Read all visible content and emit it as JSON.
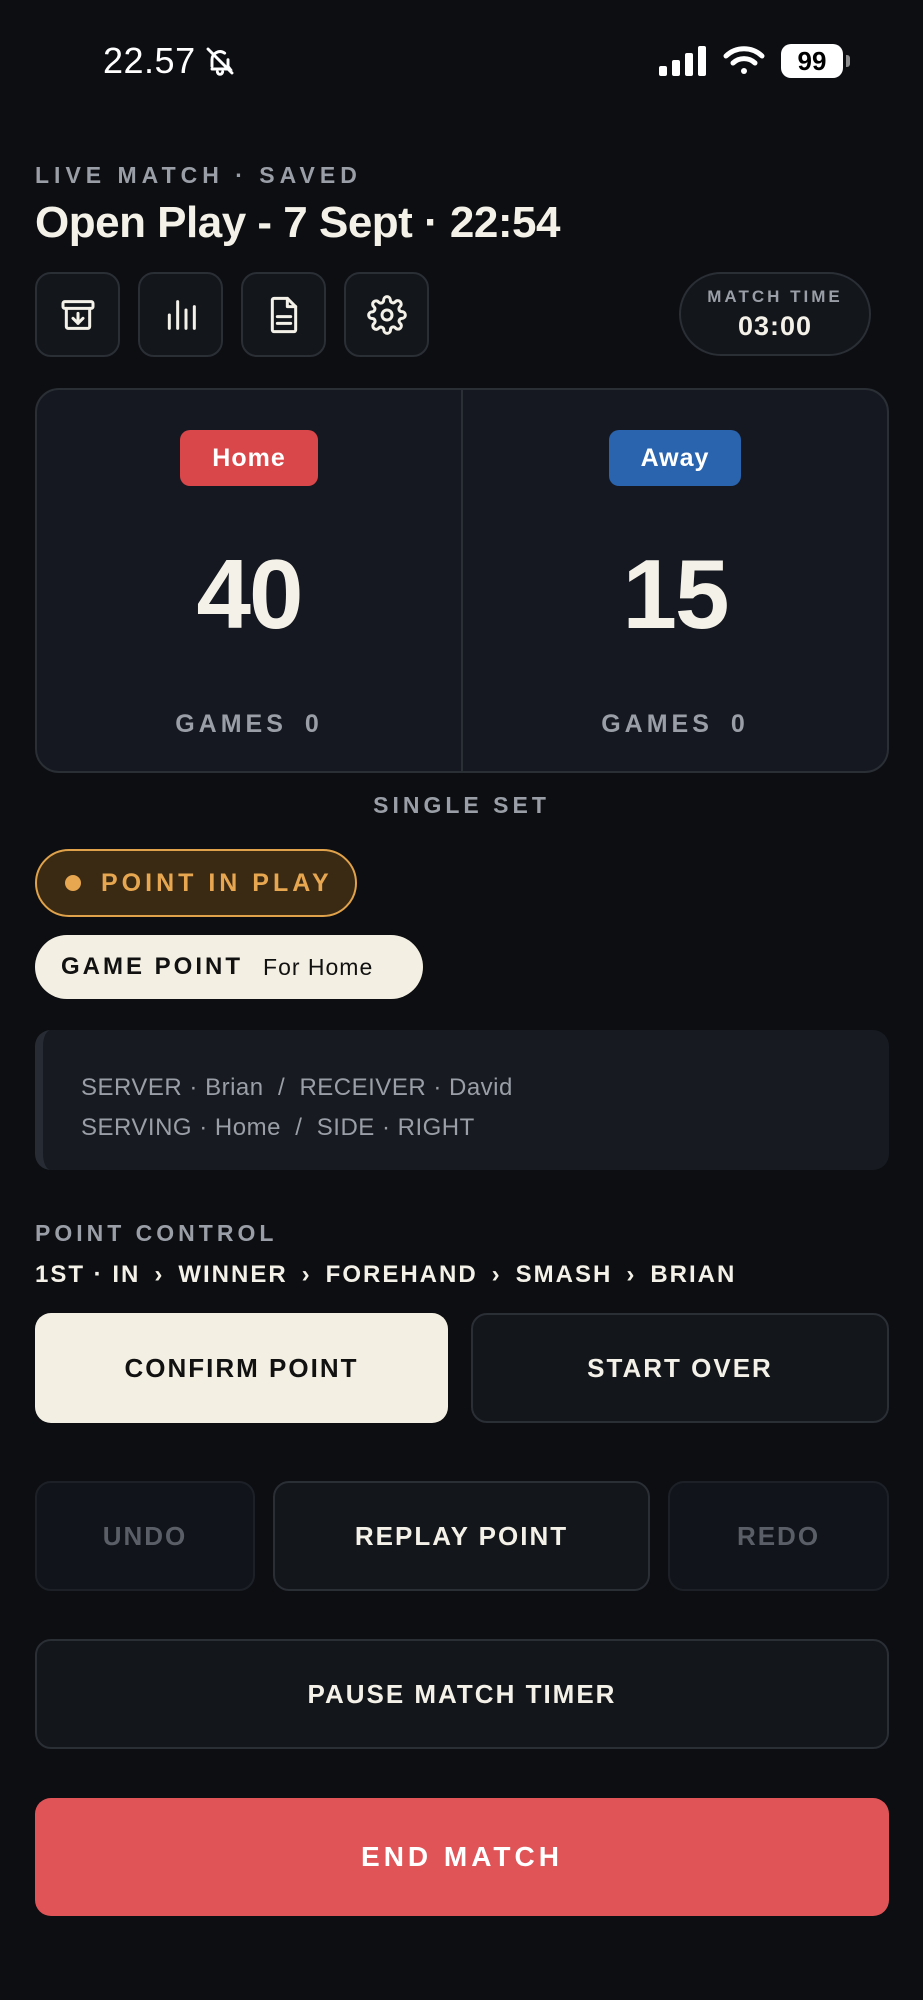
{
  "status_bar": {
    "time": "22.57",
    "battery": "99"
  },
  "header": {
    "eyebrow": "LIVE MATCH · SAVED",
    "title": "Open Play - 7 Sept · 22:54"
  },
  "toolbar": {
    "icons": [
      "archive-download-icon",
      "stats-bars-icon",
      "document-icon",
      "gear-icon"
    ]
  },
  "match_time": {
    "label": "MATCH TIME",
    "value": "03:00"
  },
  "scoreboard": {
    "home": {
      "team": "Home",
      "points": "40",
      "games_label": "GAMES",
      "games": "0",
      "color": "#d9474a"
    },
    "away": {
      "team": "Away",
      "points": "15",
      "games_label": "GAMES",
      "games": "0",
      "color": "#2a63ae"
    }
  },
  "set_label": "SINGLE SET",
  "point_status": {
    "label": "POINT IN PLAY",
    "color": "#e7a650"
  },
  "game_point": {
    "label": "GAME POINT",
    "for": "For Home"
  },
  "info": {
    "line1": "SERVER · Brian  /  RECEIVER · David",
    "line2": "SERVING · Home  /  SIDE · RIGHT"
  },
  "point_control": {
    "label": "POINT CONTROL",
    "path": [
      "1ST · IN",
      "WINNER",
      "FOREHAND",
      "SMASH",
      "BRIAN"
    ],
    "separator": "›"
  },
  "buttons": {
    "confirm": "CONFIRM POINT",
    "start_over": "START OVER",
    "undo": "UNDO",
    "replay": "REPLAY POINT",
    "redo": "REDO",
    "pause": "PAUSE MATCH TIMER",
    "end": "END MATCH"
  }
}
